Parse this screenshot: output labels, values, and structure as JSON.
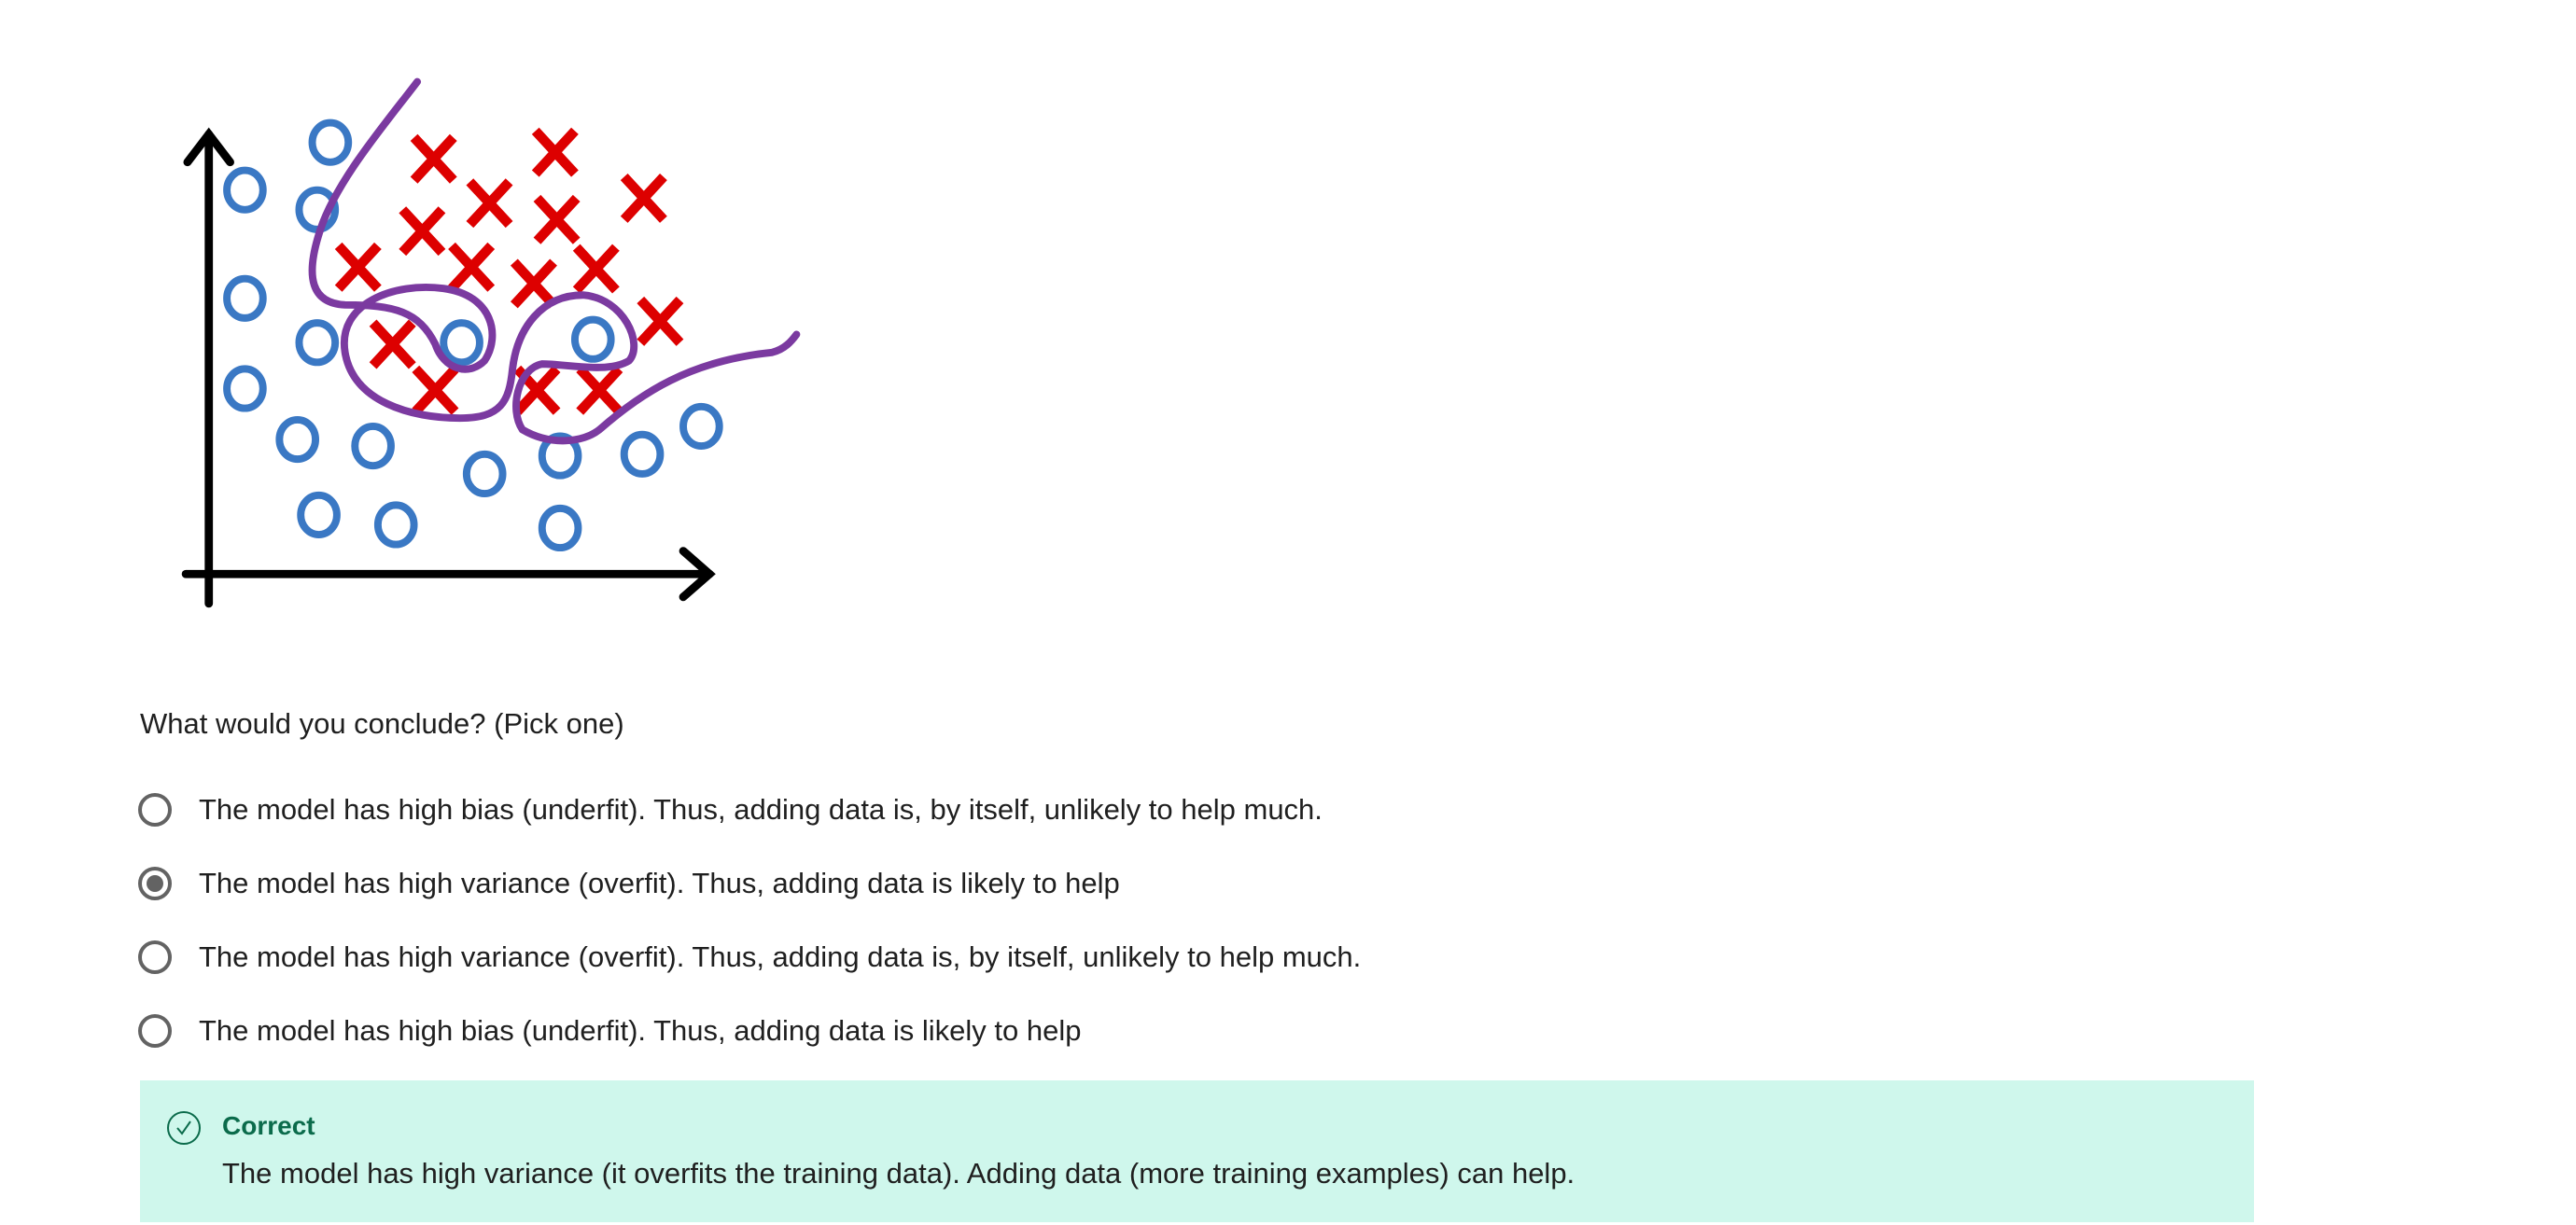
{
  "figure": {
    "colors": {
      "circle": "#3a78c4",
      "cross": "#dd0000",
      "boundary": "#7b3aa0",
      "axis": "#000000"
    }
  },
  "question": {
    "text": "What would you conclude? (Pick one)"
  },
  "options": [
    {
      "label": "The model has high bias (underfit). Thus, adding data is, by itself, unlikely to help much.",
      "selected": false
    },
    {
      "label": "The model has high variance (overfit). Thus, adding data is likely to help",
      "selected": true
    },
    {
      "label": "The model has high variance (overfit). Thus, adding data is, by itself, unlikely to help much.",
      "selected": false
    },
    {
      "label": "The model has high bias (underfit). Thus, adding data is likely to help",
      "selected": false
    }
  ],
  "feedback": {
    "icon": "check-circle-icon",
    "title": "Correct",
    "text": "The model has high variance (it overfits the training data). Adding data (more training examples) can help.",
    "bg_color": "#cff7ec",
    "accent_color": "#0b6b4b"
  }
}
